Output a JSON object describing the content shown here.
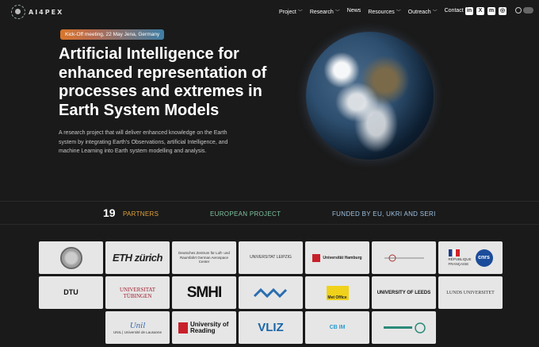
{
  "nav": {
    "logo_text": "AI4PEX",
    "menu": [
      {
        "label": "Project",
        "caret": true
      },
      {
        "label": "Research",
        "caret": true
      },
      {
        "label": "News",
        "caret": false
      },
      {
        "label": "Resources",
        "caret": true
      },
      {
        "label": "Outreach",
        "caret": true
      },
      {
        "label": "Contact",
        "caret": false
      }
    ],
    "social": [
      {
        "icon": "linkedin-icon",
        "glyph": "in"
      },
      {
        "icon": "x-icon",
        "glyph": "X"
      },
      {
        "icon": "mastodon-icon",
        "glyph": "m"
      },
      {
        "icon": "instagram-icon",
        "glyph": "◎"
      }
    ]
  },
  "hero": {
    "badge": "Kick-Off meeting, 22 May Jena, Germany",
    "title": "Artificial Intelligence for enhanced representation of processes and extremes in Earth System Models",
    "description": "A research project that will deliver enhanced knowledge on the Earth system by integrating Earth's Observations, artificial Intelligence, and machine Learning into Earth system modelling and analysis."
  },
  "stats": {
    "count": "19",
    "partners_label": "PARTNERS",
    "european_label": "EUROPEAN PROJECT",
    "funded_label": "FUNDED BY EU, UKRI AND SERI"
  },
  "partners": {
    "eth": "ETH zürich",
    "dlr": "Deutsches Zentrum für Luft- und Raumfahrt German Aerospace Center",
    "leipzig": "UNIVERSITAT LEIPZIG",
    "hamburg": "Universität Hamburg",
    "rf": "RÉPUBLIQUE FRANÇAISE",
    "cnrs": "cnrs",
    "dtu": "DTU",
    "tubingen": "UNIVERSITAT TÜBINGEN",
    "smhi": "SMHI",
    "metoffice": "Met Office",
    "leeds": "UNIVERSITY OF LEEDS",
    "lund": "LUNDS UNIVERSITET",
    "unil": "Unil",
    "unil_sub": "UNIL | Université de Lausanne",
    "reading": "University of Reading",
    "vliz": "VLIZ",
    "cb": "CB IM"
  }
}
